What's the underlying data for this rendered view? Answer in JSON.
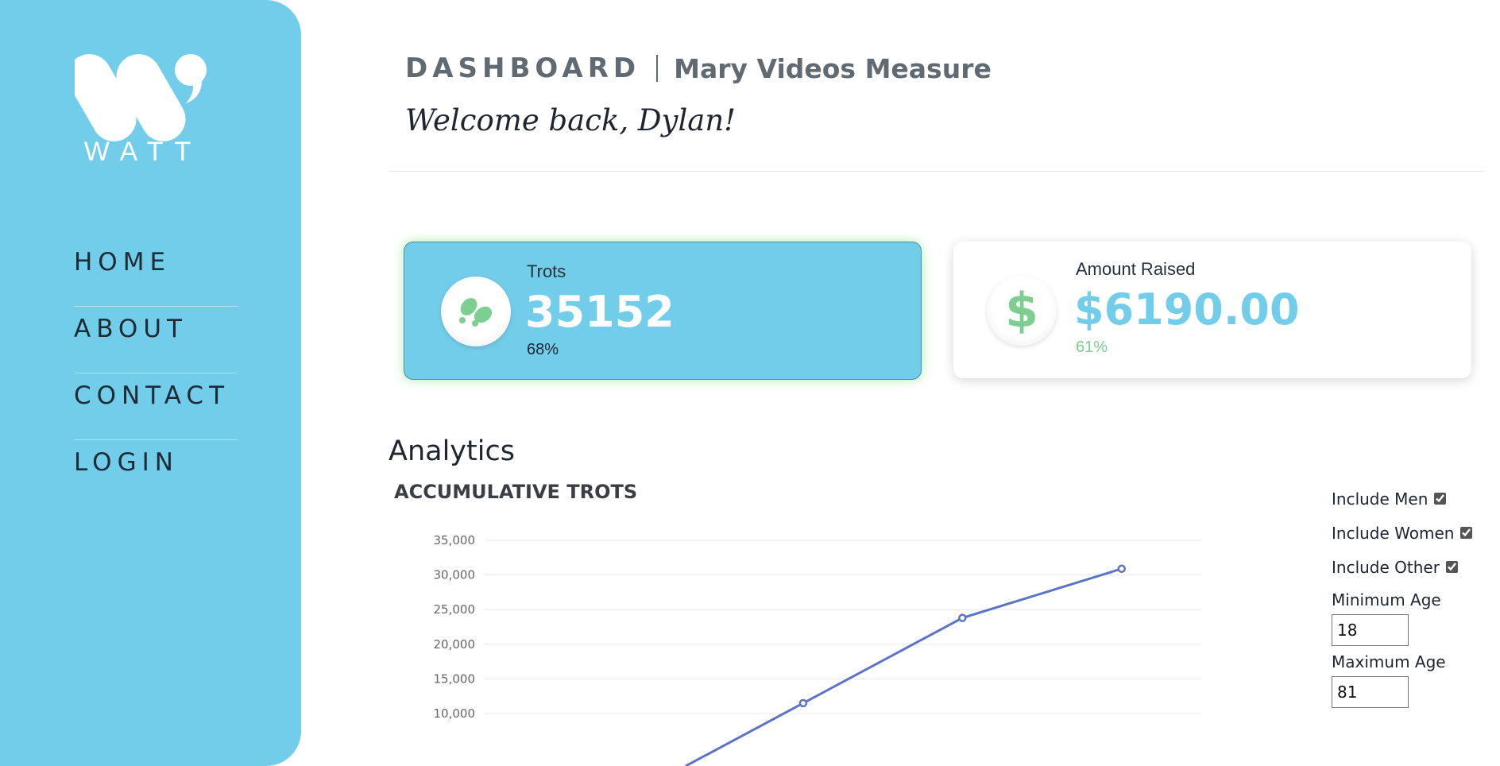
{
  "sidebar": {
    "logo_text": "WATT",
    "nav": [
      {
        "label": "HOME"
      },
      {
        "label": "ABOUT"
      },
      {
        "label": "CONTACT"
      },
      {
        "label": "LOGIN"
      }
    ],
    "color": "#72cdea"
  },
  "header": {
    "title": "DASHBOARD",
    "program": "Mary Videos Measure",
    "welcome": "Welcome back, Dylan!"
  },
  "cards": {
    "trots": {
      "label": "Trots",
      "value": "35152",
      "percent": "68%",
      "icon": "footprints-icon"
    },
    "amount": {
      "label": "Amount Raised",
      "value": "$6190.00",
      "percent": "61%",
      "icon": "dollar-icon",
      "icon_glyph": "$"
    }
  },
  "analytics": {
    "title": "Analytics",
    "filters": {
      "include_men": {
        "label": "Include Men",
        "checked": true
      },
      "include_women": {
        "label": "Include Women",
        "checked": true
      },
      "include_other": {
        "label": "Include Other",
        "checked": true
      },
      "min_age": {
        "label": "Minimum Age",
        "value": "18"
      },
      "max_age": {
        "label": "Maximum Age",
        "value": "81"
      }
    }
  },
  "chart_data": {
    "type": "line",
    "title": "ACCUMULATIVE TROTS",
    "xlabel": "",
    "ylabel": "",
    "yticks": [
      "35,000",
      "30,000",
      "25,000",
      "20,000",
      "15,000",
      "10,000"
    ],
    "ylim": [
      5000,
      35000
    ],
    "x": [
      2,
      3,
      4
    ],
    "xlim": [
      0,
      4.5
    ],
    "series": [
      {
        "values": [
          11500,
          23800,
          30900
        ],
        "color": "#5b74c7"
      }
    ],
    "grid": true
  }
}
